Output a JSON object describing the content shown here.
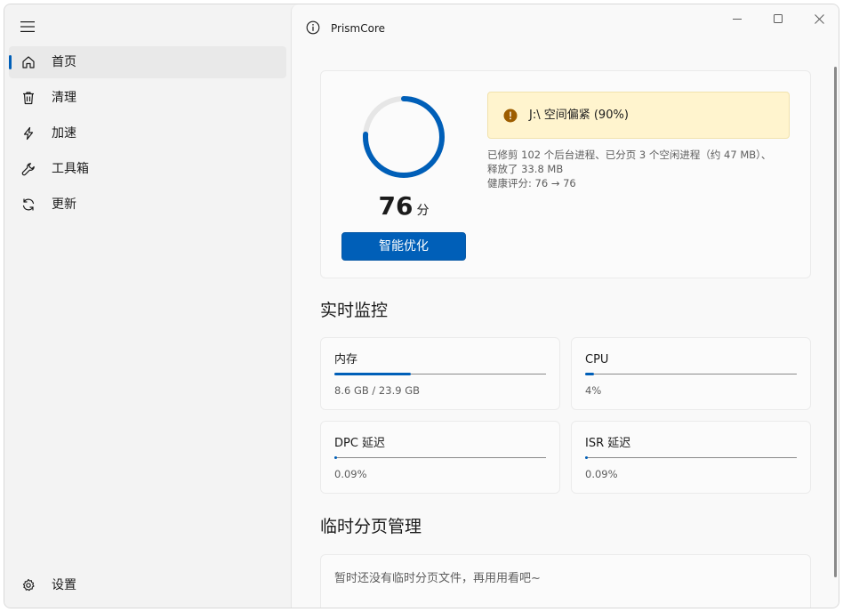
{
  "sidebar": {
    "menu_icon": "hamburger-menu-icon",
    "items": [
      {
        "label": "首页",
        "icon": "home-icon",
        "active": true
      },
      {
        "label": "清理",
        "icon": "trash-icon",
        "active": false
      },
      {
        "label": "加速",
        "icon": "lightning-icon",
        "active": false
      },
      {
        "label": "工具箱",
        "icon": "wrench-icon",
        "active": false
      },
      {
        "label": "更新",
        "icon": "refresh-icon",
        "active": false
      }
    ],
    "settings": {
      "label": "设置",
      "icon": "gear-icon"
    }
  },
  "titlebar": {
    "title": "PrismCore",
    "icon": "info-icon",
    "controls": [
      "minimize-icon",
      "maximize-icon",
      "close-icon"
    ]
  },
  "health": {
    "score": "76",
    "score_fraction": 0.76,
    "unit": "分",
    "optimize_label": "智能优化",
    "warning": "J:\\ 空间偏紧 (90%)",
    "summary_line1": "已修剪 102 个后台进程、已分页 3 个空闲进程（约 47 MB）、",
    "summary_line2": "释放了 33.8 MB",
    "summary_line3": "健康评分: 76 → 76"
  },
  "monitor": {
    "title": "实时监控",
    "metrics": [
      {
        "label": "内存",
        "value": "8.6 GB  /  23.9 GB",
        "fraction": 0.36
      },
      {
        "label": "CPU",
        "value": "4%",
        "fraction": 0.04
      },
      {
        "label": "DPC 延迟",
        "value": "0.09%",
        "fraction": 0.009
      },
      {
        "label": "ISR 延迟",
        "value": "0.09%",
        "fraction": 0.009
      }
    ]
  },
  "pagefile": {
    "title": "临时分页管理",
    "empty_text": "暂时还没有临时分页文件，再用用看吧~"
  },
  "colors": {
    "accent": "#005fb8",
    "warning_bg": "#fff4ce",
    "warning_icon": "#9d5d00"
  }
}
